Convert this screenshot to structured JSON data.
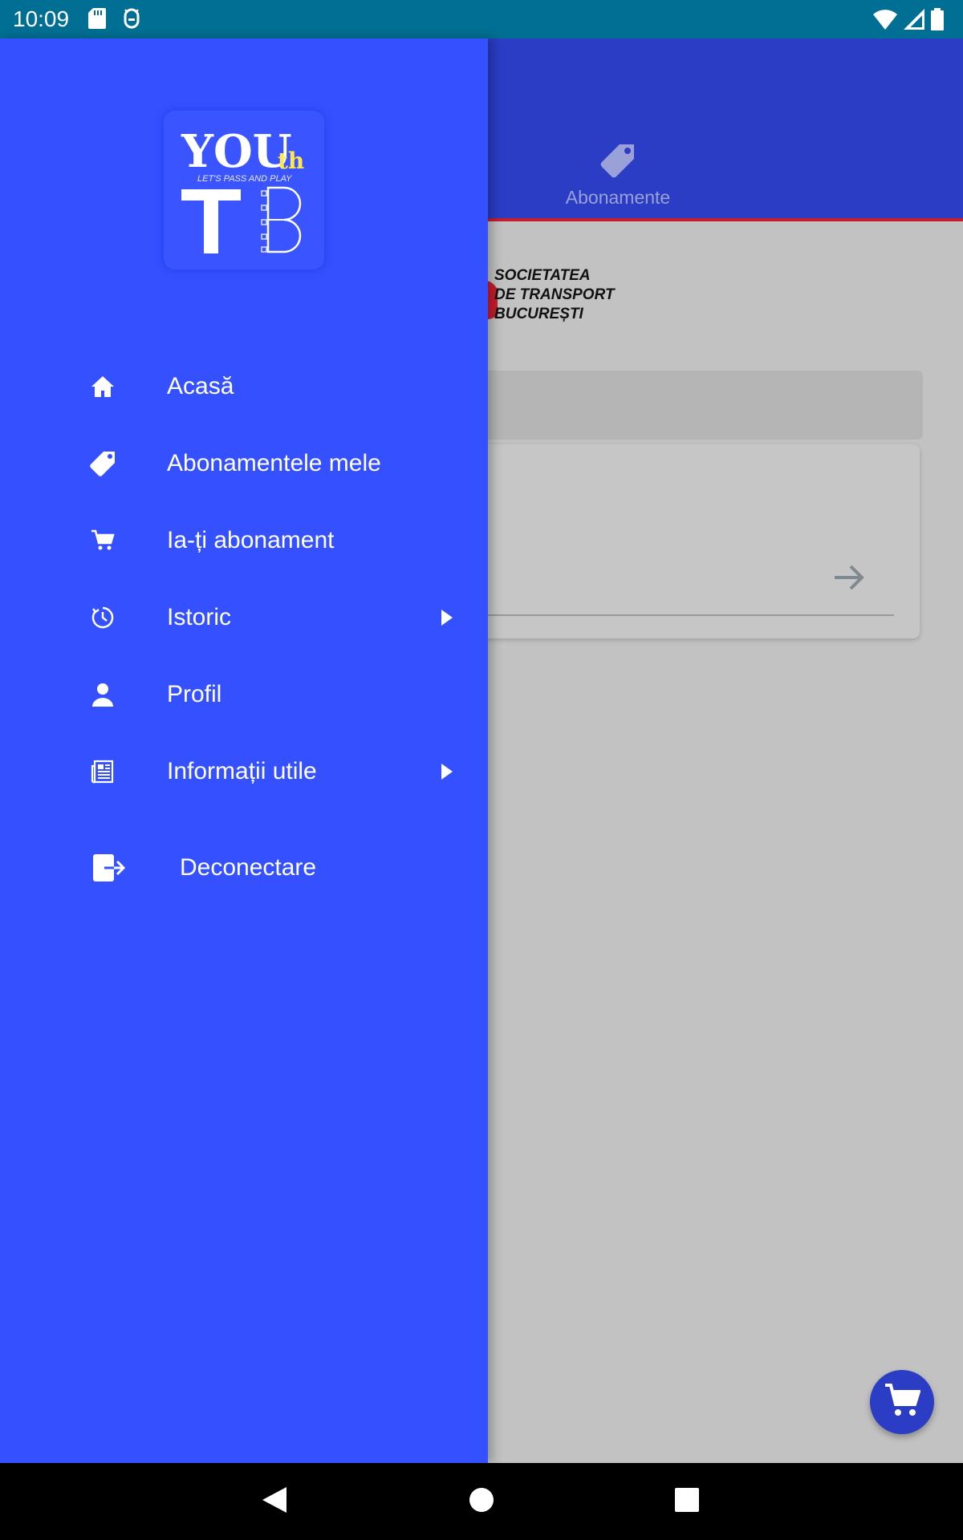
{
  "status_bar": {
    "time": "10:09",
    "left_icons": [
      "sd-card-icon",
      "android-debug-icon"
    ],
    "right_icons": [
      "wifi-icon",
      "cellular-signal-icon",
      "battery-icon"
    ]
  },
  "background_screen": {
    "header_color": "#2a3dc4",
    "tab_label": "Abonamente",
    "tab_icon": "tag-icon",
    "stb_logo_lines": [
      "SOCIETATEA",
      "DE TRANSPORT",
      "BUCUREȘTI"
    ],
    "fab_icon": "cart-icon"
  },
  "drawer": {
    "background_color": "#3450ff",
    "logo": {
      "word_top": "YOU",
      "word_th": "th",
      "tagline": "LET'S PASS AND PLAY",
      "letter_left": "T",
      "letter_right": "B"
    },
    "items": [
      {
        "label": "Acasă",
        "icon": "home-icon",
        "has_submenu": false
      },
      {
        "label": "Abonamentele mele",
        "icon": "tag-icon",
        "has_submenu": false
      },
      {
        "label": "Ia-ți abonament",
        "icon": "cart-icon",
        "has_submenu": false
      },
      {
        "label": "Istoric",
        "icon": "history-icon",
        "has_submenu": true
      },
      {
        "label": "Profil",
        "icon": "person-icon",
        "has_submenu": false
      },
      {
        "label": "Informații utile",
        "icon": "newspaper-icon",
        "has_submenu": true
      }
    ],
    "logout": {
      "label": "Deconectare",
      "icon": "logout-icon"
    }
  },
  "nav_bar": {
    "buttons": [
      "back-icon",
      "home-circle-icon",
      "recents-icon"
    ]
  }
}
